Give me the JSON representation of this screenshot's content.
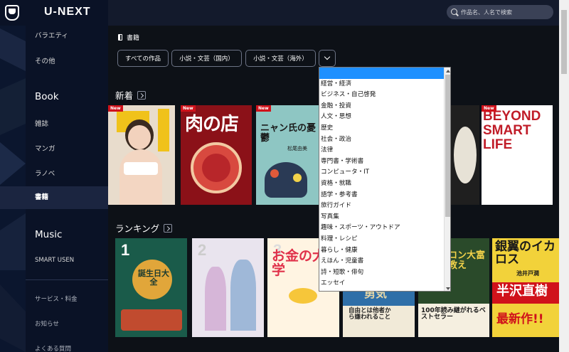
{
  "app": {
    "logo": "U-NEXT"
  },
  "search": {
    "placeholder": "作品名、人名で検索"
  },
  "sidebar": {
    "items": [
      {
        "label": "バラエティ"
      },
      {
        "label": "その他"
      },
      {
        "label": "Book"
      },
      {
        "label": "雑誌"
      },
      {
        "label": "マンガ"
      },
      {
        "label": "ラノベ"
      },
      {
        "label": "書籍"
      },
      {
        "label": "Music"
      },
      {
        "label": "SMART USEN"
      },
      {
        "label": "サービス・料金"
      },
      {
        "label": "お知らせ"
      },
      {
        "label": "よくある質問"
      }
    ]
  },
  "page": {
    "title": "書籍"
  },
  "filters": {
    "all": "すべての作品",
    "domestic": "小説・文芸（国内）",
    "overseas": "小説・文芸（海外）"
  },
  "rows": {
    "new": "新着",
    "ranking": "ランキング"
  },
  "badge": "New",
  "covers": {
    "new2_title": "肉の店",
    "new3_title": "ニャン氏の憂鬱",
    "new3_author": "松尾由美",
    "new5_title": "BEYOND SMART LIFE",
    "rank1_title": "誕生日大全",
    "rank3_title": "お金の大学",
    "rank4_title": "自由とは他者から嫌われること",
    "rank4_sub": "勇気",
    "rank5_title": "バビロン大富豪の教え",
    "rank5_sub": "100年読み継がれるベストセラー",
    "rank6_title": "銀翼のイカロス",
    "rank6_author": "池井戸潤",
    "rank6_banner": "半沢直樹",
    "rank6_sub": "最新作!!"
  },
  "dropdown": {
    "options": [
      "",
      "経営・経済",
      "ビジネス・自己啓発",
      "金融・投資",
      "人文・思想",
      "歴史",
      "社会・政治",
      "法律",
      "専門書・学術書",
      "コンピュータ・IT",
      "資格・就職",
      "語学・参考書",
      "旅行ガイド",
      "写真集",
      "趣味・スポーツ・アウトドア",
      "料理・レシピ",
      "暮らし・健康",
      "えほん・児童書",
      "詩・短歌・俳句",
      "エッセイ"
    ],
    "selected_index": 0
  },
  "colors": {
    "accent_new": "#d0121b",
    "selection": "#1e90ff",
    "sidebar_bg": "#0a1226"
  }
}
